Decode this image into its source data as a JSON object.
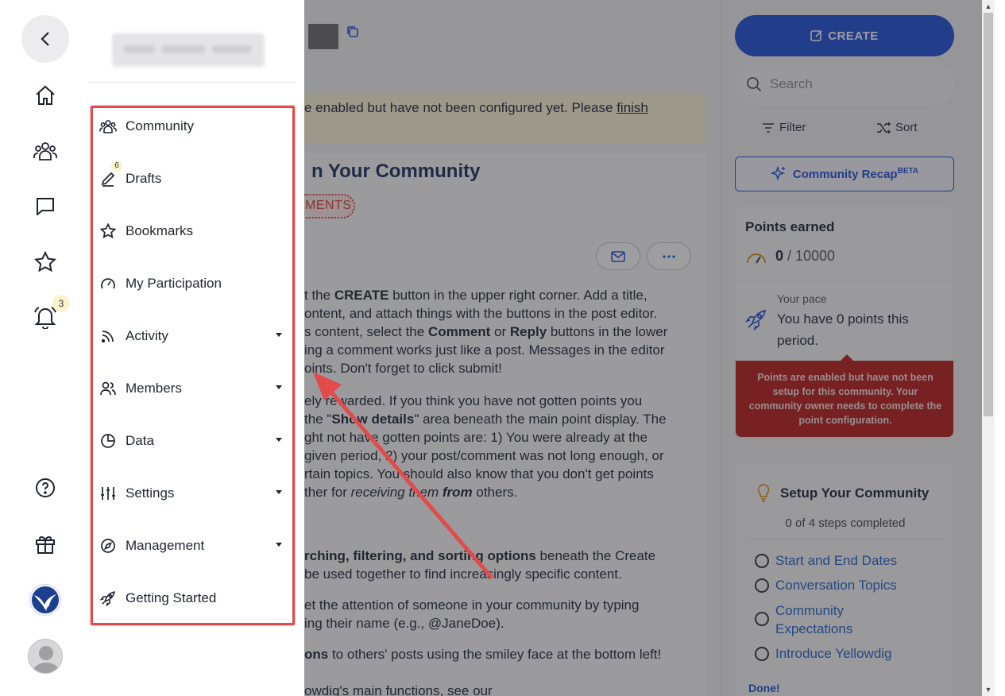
{
  "main": {
    "banner": {
      "text": "e enabled but have not been configured yet. Please ",
      "link": "finish"
    },
    "post": {
      "title": "n Your Community",
      "tag": "MENTS",
      "paragraphs": [
        [
          "t the CREATE button in the upper right corner. Add a title,",
          "ontent, and attach things with the buttons in the post editor.",
          "s content, select the Comment or Reply buttons in the lower",
          "ing a comment works just like a post. Messages in the editor",
          "oints. Don't forget to click submit!"
        ],
        [
          "ely rewarded. If you think you have not gotten points you",
          " the \"Show details\" area beneath the main point display. The",
          "ght not have gotten points are: 1) You were already at the",
          "given period, 2) your post/comment was not long enough, or",
          "rtain topics. You should also know that you don't get points",
          "ther for receiving them from others."
        ],
        [
          "rching, filtering, and sorting options beneath the Create",
          "be used together to find increasingly specific content."
        ],
        [
          "et the attention of someone in your community by typing",
          "ing their name (e.g., @JaneDoe)."
        ],
        [
          "ons to others' posts using the smiley face at the bottom left!"
        ],
        [
          "owdig's main functions, see our"
        ]
      ]
    }
  },
  "right": {
    "create_label": "CREATE",
    "search_placeholder": "Search",
    "filter_label": "Filter",
    "sort_label": "Sort",
    "recap_label": "Community Recap",
    "recap_sup": "BETA",
    "points": {
      "title": "Points earned",
      "value": "0",
      "max": " / 10000",
      "pace_label": "Your pace",
      "pace_text": "You have 0 points this period.",
      "warning": "Points are enabled but have not been setup for this community. Your community owner needs to complete the point configuration."
    },
    "setup": {
      "title": "Setup Your Community",
      "subtitle": "0 of 4 steps completed",
      "steps": [
        "Start and End Dates",
        "Conversation Topics",
        "Community Expectations",
        "Introduce Yellowdig"
      ],
      "done": "Done!"
    }
  },
  "rail": {
    "bell_count": "3",
    "icons": [
      "back-icon",
      "home-icon",
      "community-icon",
      "chat-icon",
      "star-icon",
      "bell-icon",
      "help-icon",
      "gift-icon"
    ]
  },
  "menu": {
    "items": [
      {
        "label": "Community",
        "icon": "community-icon"
      },
      {
        "label": "Drafts",
        "icon": "pencil-icon",
        "badge": "6"
      },
      {
        "label": "Bookmarks",
        "icon": "star-icon"
      },
      {
        "label": "My Participation",
        "icon": "gauge-icon"
      },
      {
        "label": "Activity",
        "icon": "rss-icon",
        "expandable": true
      },
      {
        "label": "Members",
        "icon": "members-icon",
        "expandable": true
      },
      {
        "label": "Data",
        "icon": "pie-chart-icon",
        "expandable": true
      },
      {
        "label": "Settings",
        "icon": "sliders-icon",
        "expandable": true
      },
      {
        "label": "Management",
        "icon": "compass-icon",
        "expandable": true
      },
      {
        "label": "Getting Started",
        "icon": "rocket-icon"
      }
    ]
  },
  "colors": {
    "accent": "#1e4fd6",
    "annotation": "#e34a4a",
    "warning": "#b91c1c"
  }
}
